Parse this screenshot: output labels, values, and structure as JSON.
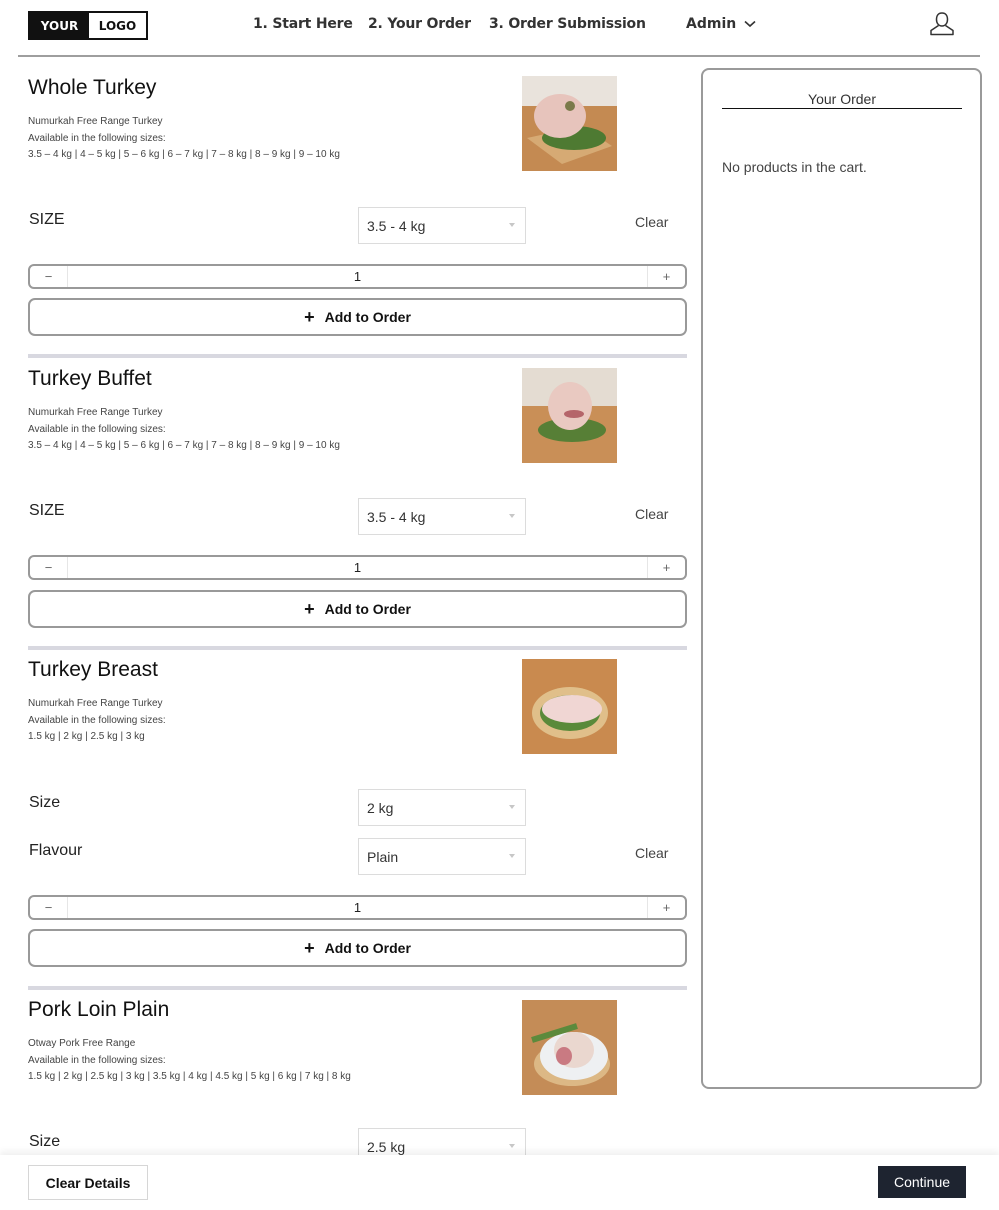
{
  "header": {
    "logo": {
      "part1": "YOUR",
      "part2": "LOGO"
    },
    "nav": [
      {
        "label": "1. Start Here"
      },
      {
        "label": "2. Your Order"
      },
      {
        "label": "3. Order Submission"
      }
    ],
    "user_menu": {
      "label": "Admin",
      "icon": "chevron-down-icon"
    },
    "account_icon": "user-icon"
  },
  "products": [
    {
      "title": "Whole Turkey",
      "supplier": "Numurkah Free Range Turkey",
      "sizes_intro": "Available in the following sizes:",
      "sizes": "3.5 – 4 kg | 4 – 5 kg | 5 – 6 kg | 6 – 7 kg | 7 – 8 kg | 8 – 9 kg | 9 – 10 kg",
      "options": [
        {
          "label": "SIZE",
          "value": "3.5 - 4 kg"
        }
      ],
      "clear_label": "Clear",
      "quantity": "1",
      "minus": "−",
      "plus": "+",
      "add_label": "Add to Order"
    },
    {
      "title": "Turkey Buffet",
      "supplier": "Numurkah Free Range Turkey",
      "sizes_intro": "Available in the following sizes:",
      "sizes": "3.5 – 4 kg | 4 – 5 kg | 5 – 6 kg | 6 – 7 kg | 7 – 8 kg | 8 – 9 kg | 9 – 10 kg",
      "options": [
        {
          "label": "SIZE",
          "value": "3.5 - 4 kg"
        }
      ],
      "clear_label": "Clear",
      "quantity": "1",
      "minus": "−",
      "plus": "+",
      "add_label": "Add to Order"
    },
    {
      "title": "Turkey Breast",
      "supplier": "Numurkah Free Range Turkey",
      "sizes_intro": "Available in the following sizes:",
      "sizes": "1.5 kg | 2 kg | 2.5 kg | 3 kg",
      "options": [
        {
          "label": "Size",
          "value": "2 kg"
        },
        {
          "label": "Flavour",
          "value": "Plain"
        }
      ],
      "clear_label": "Clear",
      "quantity": "1",
      "minus": "−",
      "plus": "+",
      "add_label": "Add to Order"
    },
    {
      "title": "Pork Loin Plain",
      "supplier": "Otway Pork Free Range",
      "sizes_intro": "Available in the following sizes:",
      "sizes": "1.5 kg | 2 kg | 2.5 kg | 3 kg | 3.5 kg | 4 kg | 4.5 kg | 5 kg | 6 kg | 7 kg | 8 kg",
      "options": [
        {
          "label": "Size",
          "value": "2.5 kg"
        }
      ]
    }
  ],
  "order": {
    "title": "Your Order",
    "empty_message": "No products in the cart."
  },
  "footer": {
    "clear_label": "Clear Details",
    "continue_label": "Continue"
  },
  "colors": {
    "continue_bg": "#1e2430",
    "separator": "#d8d8e0",
    "border": "#999999"
  }
}
